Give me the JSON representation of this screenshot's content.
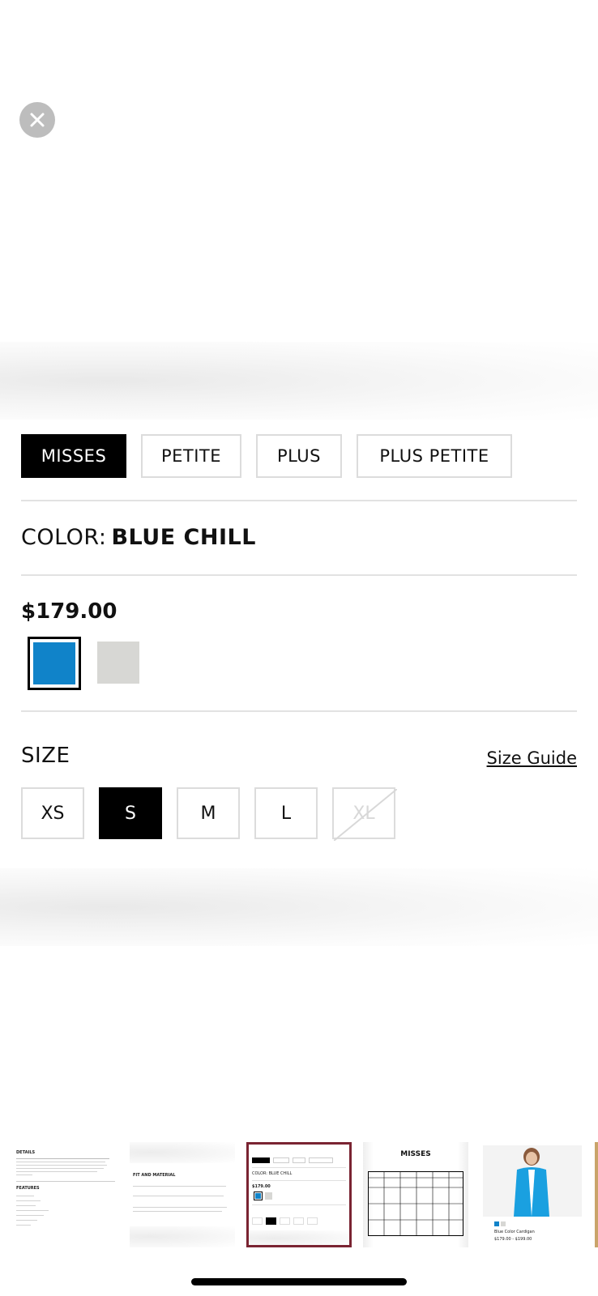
{
  "modal": {
    "close_icon": "close-icon"
  },
  "fit_tabs": [
    {
      "label": "MISSES",
      "active": true
    },
    {
      "label": "PETITE",
      "active": false
    },
    {
      "label": "PLUS",
      "active": false
    },
    {
      "label": "PLUS PETITE",
      "active": false
    }
  ],
  "color": {
    "label": "COLOR:",
    "value": "BLUE CHILL"
  },
  "price": "$179.00",
  "swatches": [
    {
      "name": "Blue Chill",
      "hex": "#1083c9",
      "selected": true
    },
    {
      "name": "light gray",
      "hex": "#d7d7d4",
      "selected": false
    }
  ],
  "size": {
    "title": "SIZE",
    "guide_link": "Size Guide",
    "options": [
      {
        "label": "XS",
        "state": "available"
      },
      {
        "label": "S",
        "state": "selected"
      },
      {
        "label": "M",
        "state": "available"
      },
      {
        "label": "L",
        "state": "available"
      },
      {
        "label": "XL",
        "state": "unavailable"
      }
    ]
  },
  "thumbnails": {
    "selected_index": 2,
    "items": [
      {
        "kind": "details",
        "heading": "DETAILS",
        "subheading": "FEATURES"
      },
      {
        "kind": "fit-material",
        "heading": "FIT AND MATERIAL"
      },
      {
        "kind": "options",
        "heading": "COLOR: BLUE CHILL",
        "price": "$179.00"
      },
      {
        "kind": "size-chart",
        "heading": "MISSES"
      },
      {
        "kind": "product-photo",
        "caption": "Blue Color Cardigan",
        "price": "$179.00 - $199.00"
      }
    ]
  },
  "colors": {
    "accent": "#000000",
    "selected_thumb_border": "#7a2432",
    "divider": "#e2e2e2"
  }
}
